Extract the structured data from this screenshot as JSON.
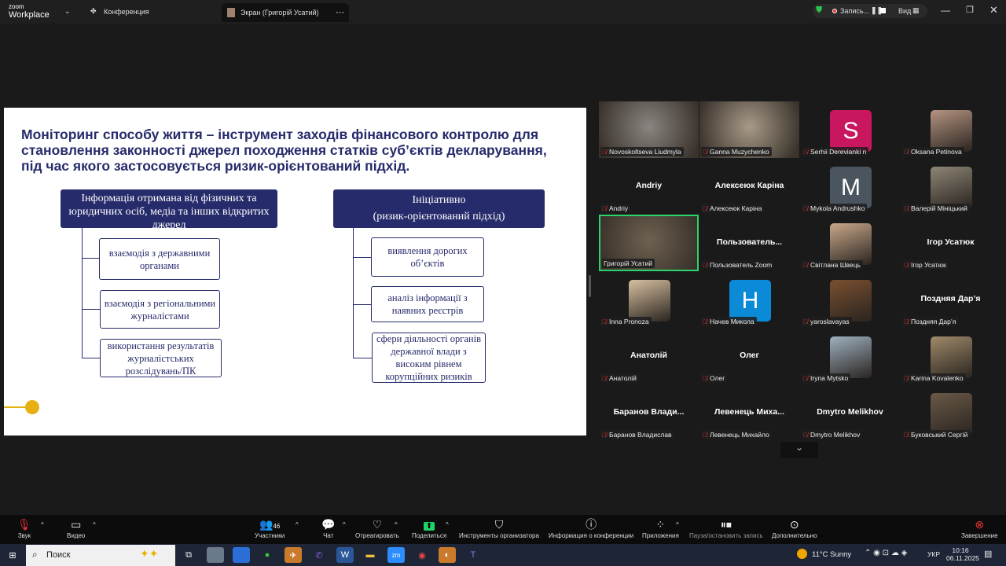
{
  "topbar": {
    "logo_small": "zoom",
    "logo_big": "Workplace",
    "meeting_label": "Конференция",
    "screen_tab": "Экран (Григорій Усатий)",
    "recording": "Запись...",
    "view": "Вид"
  },
  "slide": {
    "title": "Моніторинг способу життя – інструмент заходів фінансового контролю для становлення законності джерел походження статків суб’єктів декларування, під час якого застосовується ризик-орієнтований підхід.",
    "left_header": "Інформація отримана від фізичних та юридичних осіб, медіа та інших відкритих джерел",
    "left_items": [
      "взаємодія з державними органами",
      "взаємодія з регіональними журналістами",
      "використання результатів журналістських розслідувань/ПК"
    ],
    "right_header_1": "Ініціативно",
    "right_header_2": "(ризик-орієнтований підхід)",
    "right_items": [
      "виявлення дорогих об’єктів",
      "аналіз інформації з наявних реєстрів",
      "сфери діяльності органів державної влади з високим рівнем корупційних ризиків"
    ],
    "accent": "#262b6b",
    "dot_color": "#e6b012"
  },
  "participants": [
    {
      "label": "Novoskoltseva Liudmyla",
      "type": "video",
      "color": "#8a8580"
    },
    {
      "label": "Ganna Muzychenko",
      "type": "video",
      "color": "#a89a88"
    },
    {
      "label": "Serhii Derevianki n",
      "type": "avatar",
      "letter": "S",
      "color": "#c8175e"
    },
    {
      "label": "Oksana Petinova",
      "type": "photo",
      "color": "#b59480"
    },
    {
      "label": "Andriy",
      "type": "name",
      "name": "Andriy"
    },
    {
      "label": "Алексеюк Каріна",
      "type": "name",
      "name": "Алексеюк Каріна"
    },
    {
      "label": "Mykola Andrushko",
      "type": "avatar",
      "letter": "M",
      "color": "#4b5560"
    },
    {
      "label": "Валерій Мініцький",
      "type": "photo",
      "color": "#8e8676"
    },
    {
      "label": "Григорій Усатий",
      "type": "video",
      "color": "#6e6150",
      "active": true
    },
    {
      "label": "Пользователь Zoom",
      "type": "name",
      "name": "Пользователь..."
    },
    {
      "label": "Світлана Швець",
      "type": "photo",
      "color": "#c9a88a"
    },
    {
      "label": "Ігор Усатюк",
      "type": "name",
      "name": "Ігор Усатюк"
    },
    {
      "label": "Inna Pronoza",
      "type": "photo",
      "color": "#d8c0a0"
    },
    {
      "label": "Начев Микола",
      "type": "avatar",
      "letter": "H",
      "color": "#0b8ad8"
    },
    {
      "label": "yaroslavayas",
      "type": "photo",
      "color": "#7a5030"
    },
    {
      "label": "Поздняя Дар’я",
      "type": "name",
      "name": "Поздняя Дар’я"
    },
    {
      "label": "Анатолій",
      "type": "name",
      "name": "Анатолій"
    },
    {
      "label": "Олег",
      "type": "name",
      "name": "Олег"
    },
    {
      "label": "Iryna Mytsko",
      "type": "photo",
      "color": "#9fb0c0"
    },
    {
      "label": "Karina Kovalenko",
      "type": "photo",
      "color": "#a08a6a"
    },
    {
      "label": "Баранов Владислав",
      "type": "name",
      "name": "Баранов  Влади..."
    },
    {
      "label": "Левенець Михайло",
      "type": "name",
      "name": "Левенець  Миха..."
    },
    {
      "label": "Dmytro Melikhov",
      "type": "name",
      "name": "Dmytro Melikhov"
    },
    {
      "label": "Буковський Сергій",
      "type": "photo",
      "color": "#6a5a48"
    }
  ],
  "toolbar": {
    "audio": "Звук",
    "video": "Видео",
    "participants": "Участники",
    "participants_count": "46",
    "chat": "Чат",
    "react": "Отреагировать",
    "share": "Поделиться",
    "host_tools": "Инструменты организатора",
    "info": "Информация о конференции",
    "apps": "Приложения",
    "pause_rec": "Пауза/остановить запись",
    "more": "Дополнительно",
    "end": "Завершение"
  },
  "taskbar": {
    "search": "Поиск",
    "weather": "11°C  Sunny",
    "lang": "УКР",
    "time": "10:16",
    "date": "06.11.2025"
  }
}
